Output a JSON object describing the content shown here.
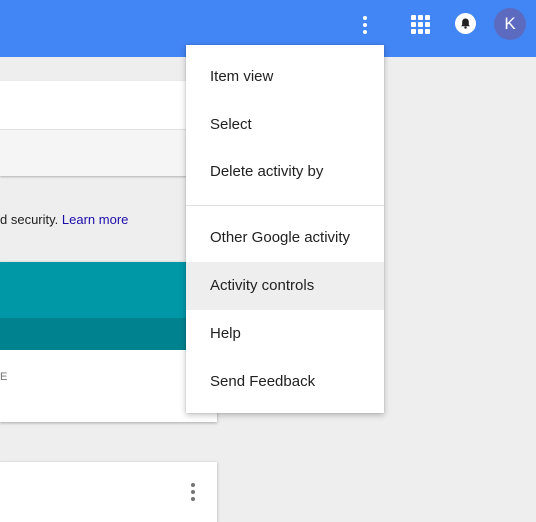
{
  "colors": {
    "top_bar": "#4285f4",
    "teal": "#0097a7",
    "teal_dark": "#00838f",
    "link": "#1a0dab",
    "avatar": "#5c6bc0"
  },
  "header": {
    "more_icon": "more-vert-icon",
    "apps_icon": "apps-grid-icon",
    "notifications_icon": "bell-icon",
    "avatar_initial": "K"
  },
  "main": {
    "info_text": "d security.",
    "learn_more": "Learn more",
    "card_label": "E"
  },
  "menu": {
    "items": [
      {
        "label": "Item view"
      },
      {
        "label": "Select"
      },
      {
        "label": "Delete activity by"
      },
      {
        "label": "Other Google activity"
      },
      {
        "label": "Activity controls",
        "highlighted": true
      },
      {
        "label": "Help"
      },
      {
        "label": "Send Feedback"
      }
    ]
  }
}
